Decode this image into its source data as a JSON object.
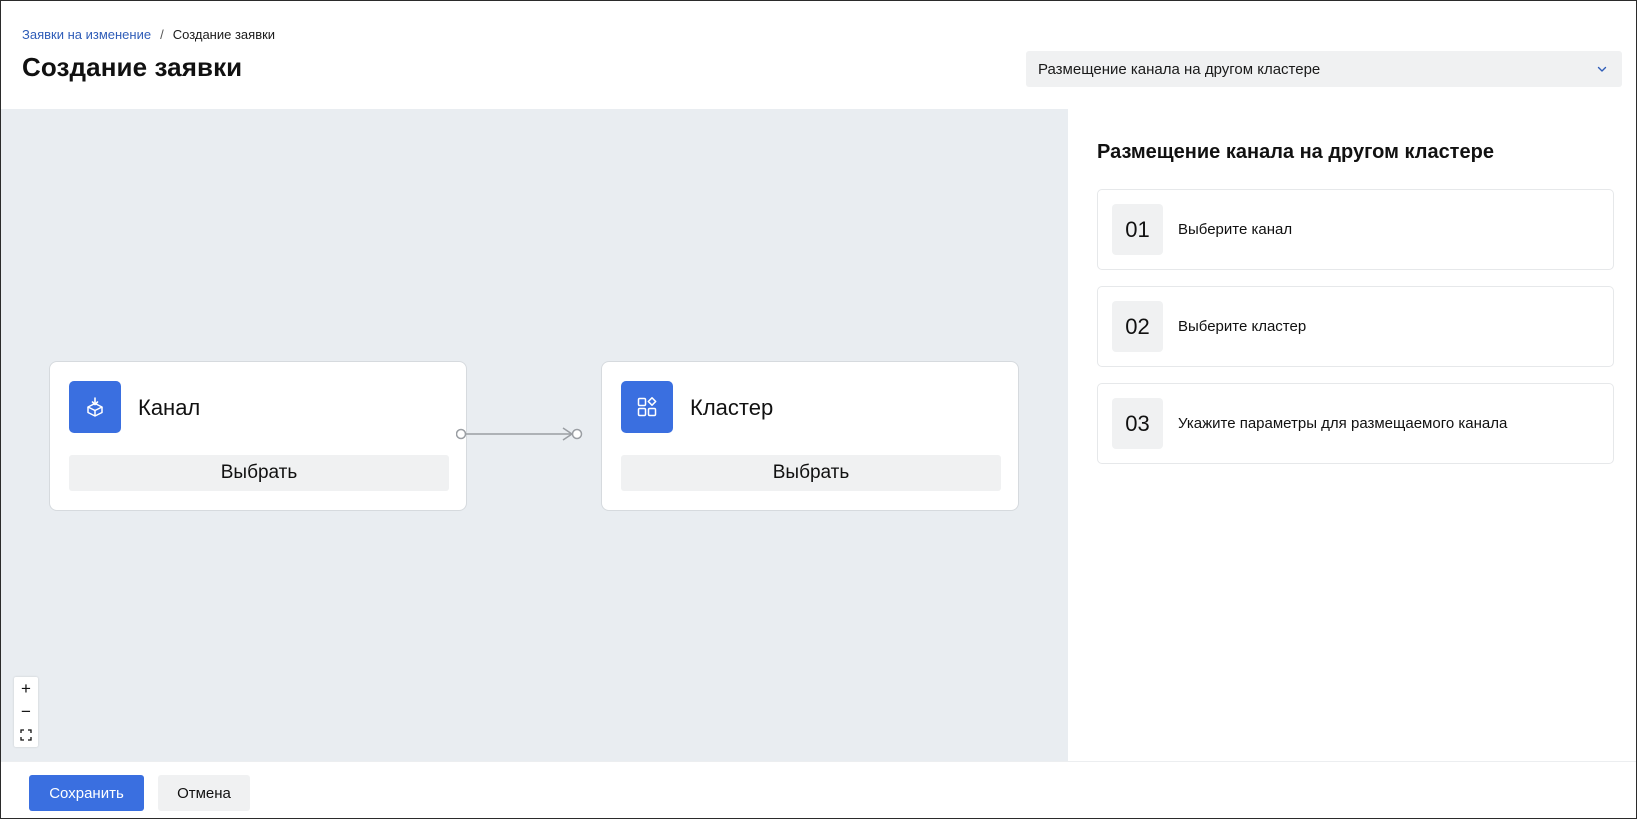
{
  "breadcrumb": {
    "parent": "Заявки на изменение",
    "separator": "/",
    "current": "Создание заявки"
  },
  "page": {
    "title": "Создание заявки"
  },
  "template_select": {
    "value": "Размещение канала на другом кластере"
  },
  "canvas": {
    "nodes": [
      {
        "icon": "box-download-icon",
        "title": "Канал",
        "button": "Выбрать"
      },
      {
        "icon": "apps-grid-icon",
        "title": "Кластер",
        "button": "Выбрать"
      }
    ],
    "zoom": {
      "in": "+",
      "out": "−"
    }
  },
  "panel": {
    "title": "Размещение канала на другом кластере",
    "steps": [
      {
        "num": "01",
        "text": "Выберите канал"
      },
      {
        "num": "02",
        "text": "Выберите кластер"
      },
      {
        "num": "03",
        "text": "Укажите параметры для размещаемого канала"
      }
    ]
  },
  "footer": {
    "save": "Сохранить",
    "cancel": "Отмена"
  },
  "colors": {
    "accent": "#3a6fe0",
    "link": "#2f5db8",
    "canvas_bg": "#e9edf1",
    "control_bg": "#f0f1f2"
  }
}
